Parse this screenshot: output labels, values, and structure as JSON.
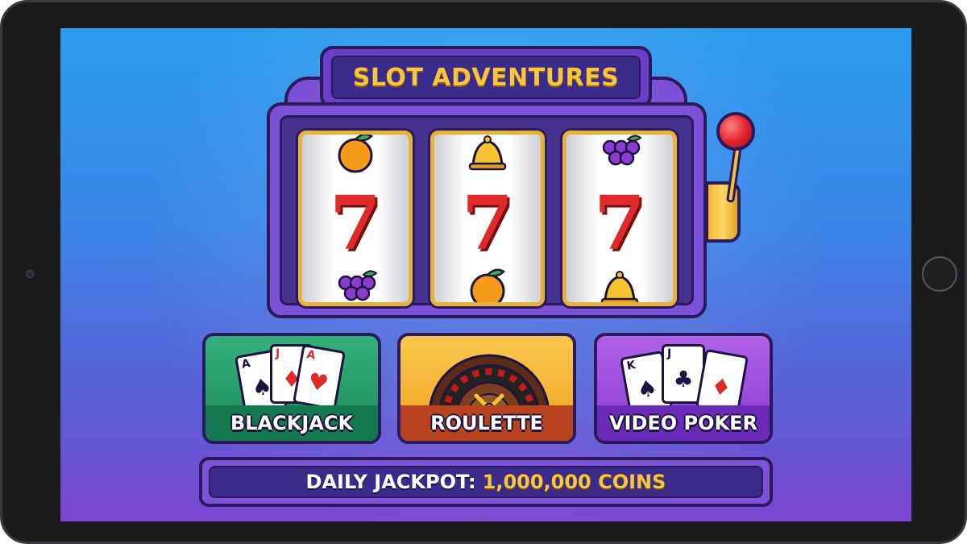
{
  "app": {
    "title": "SLOT ADVENTURES"
  },
  "reels": [
    {
      "top_symbol": "orange-icon",
      "center_symbol": "7",
      "bottom_symbol": "grapes-icon"
    },
    {
      "top_symbol": "bell-icon",
      "center_symbol": "7",
      "bottom_symbol": "orange-icon"
    },
    {
      "top_symbol": "grapes-icon",
      "center_symbol": "7",
      "bottom_symbol": "bell-icon"
    }
  ],
  "games": [
    {
      "label": "BLACKJACK",
      "icon": "playing-cards-icon",
      "cards": [
        {
          "rank": "A",
          "suit": "♠"
        },
        {
          "rank": "J",
          "suit": "♦"
        },
        {
          "rank": "A",
          "suit": "♥"
        }
      ]
    },
    {
      "label": "ROULETTE",
      "icon": "roulette-wheel-icon"
    },
    {
      "label": "VIDEO POKER",
      "icon": "playing-cards-icon",
      "cards": [
        {
          "rank": "K",
          "suit": "♠"
        },
        {
          "rank": "J",
          "suit": "♣"
        },
        {
          "rank": "",
          "suit": "♦"
        }
      ]
    }
  ],
  "jackpot": {
    "label": "DAILY JACKPOT:",
    "value": "1,000,000 COINS"
  },
  "colors": {
    "accent_gold": "#f7c63d",
    "machine_purple": "#7c52d8",
    "seven_red": "#e02a2a",
    "blackjack_green": "#1c8a5c",
    "roulette_orange": "#f0a21e",
    "poker_purple": "#8a3cd2"
  }
}
